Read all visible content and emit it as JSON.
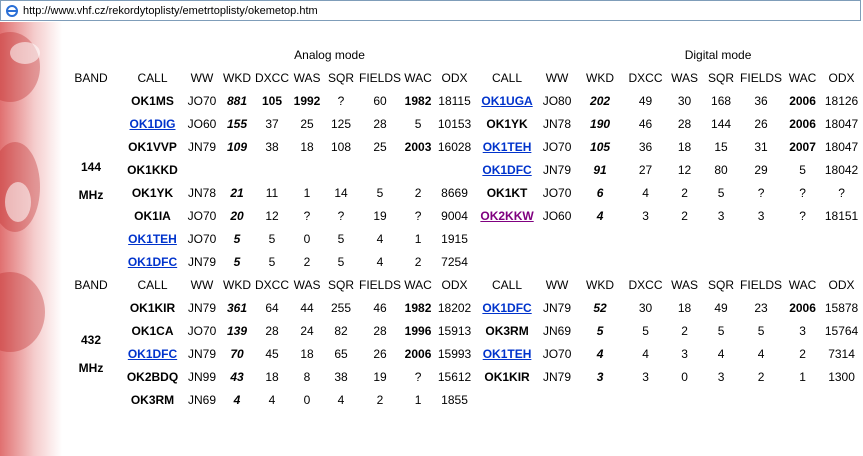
{
  "address_bar": {
    "url": "http://www.vhf.cz/rekordytoplisty/emetrtoplisty/okemetop.htm"
  },
  "colors": {
    "analog_header": "#f9bf6e",
    "digital_header": "#fffacd",
    "band_header": "#c8f0a8",
    "band_cell": "#c8f4f8",
    "highlight": "#ffff00",
    "link": "#0033cc",
    "visited_link": "#800080"
  },
  "modes": {
    "analog": "Analog mode",
    "digital": "Digital mode"
  },
  "headers": {
    "band": "BAND",
    "analog": [
      "CALL",
      "WW",
      "WKD",
      "DXCC",
      "WAS",
      "SQR",
      "FIELDS",
      "WAC",
      "ODX"
    ],
    "digital": [
      "CALL",
      "WW",
      "WKD",
      "DXCC",
      "WAS",
      "SQR",
      "FIELDS",
      "WAC",
      "ODX"
    ]
  },
  "bands": [
    {
      "label_top": "144",
      "label_bottom": "MHz",
      "analog_rows": [
        [
          "OK1MS",
          "JO70",
          "881",
          "105",
          "1992",
          "?",
          "60",
          "1982",
          "18115"
        ],
        [
          "OK1DIG",
          "JO60",
          "155",
          "37",
          "25",
          "125",
          "28",
          "5",
          "10153"
        ],
        [
          "OK1VVP",
          "JN79",
          "109",
          "38",
          "18",
          "108",
          "25",
          "2003",
          "16028"
        ],
        [
          "OK1KKD",
          "",
          "",
          "",
          "",
          "",
          "",
          "",
          ""
        ],
        [
          "OK1YK",
          "JN78",
          "21",
          "11",
          "1",
          "14",
          "5",
          "2",
          "8669"
        ],
        [
          "OK1IA",
          "JO70",
          "20",
          "12",
          "?",
          "?",
          "19",
          "?",
          "9004"
        ],
        [
          "OK1TEH",
          "JO70",
          "5",
          "5",
          "0",
          "5",
          "4",
          "1",
          "1915"
        ],
        [
          "OK1DFC",
          "JN79",
          "5",
          "5",
          "2",
          "5",
          "4",
          "2",
          "7254"
        ]
      ],
      "digital_rows": [
        [
          "OK1UGA",
          "JO80",
          "202",
          "49",
          "30",
          "168",
          "36",
          "2006",
          "18126"
        ],
        [
          "OK1YK",
          "JN78",
          "190",
          "46",
          "28",
          "144",
          "26",
          "2006",
          "18047"
        ],
        [
          "OK1TEH",
          "JO70",
          "105",
          "36",
          "18",
          "15",
          "31",
          "2007",
          "18047"
        ],
        [
          "OK1DFC",
          "JN79",
          "91",
          "27",
          "12",
          "80",
          "29",
          "5",
          "18042"
        ],
        [
          "OK1KT",
          "JO70",
          "6",
          "4",
          "2",
          "5",
          "?",
          "?",
          "?"
        ],
        [
          "OK2KKW",
          "JO60",
          "4",
          "3",
          "2",
          "3",
          "3",
          "?",
          "18151"
        ]
      ]
    },
    {
      "label_top": "432",
      "label_bottom": "MHz",
      "analog_rows": [
        [
          "OK1KIR",
          "JN79",
          "361",
          "64",
          "44",
          "255",
          "46",
          "1982",
          "18202"
        ],
        [
          "OK1CA",
          "JO70",
          "139",
          "28",
          "24",
          "82",
          "28",
          "1996",
          "15913"
        ],
        [
          "OK1DFC",
          "JN79",
          "70",
          "45",
          "18",
          "65",
          "26",
          "2006",
          "15993"
        ],
        [
          "OK2BDQ",
          "JN99",
          "43",
          "18",
          "8",
          "38",
          "19",
          "?",
          "15612"
        ],
        [
          "OK3RM",
          "JN69",
          "4",
          "4",
          "0",
          "4",
          "2",
          "1",
          "1855"
        ]
      ],
      "digital_rows": [
        [
          "OK1DFC",
          "JN79",
          "52",
          "30",
          "18",
          "49",
          "23",
          "2006",
          "15878"
        ],
        [
          "OK3RM",
          "JN69",
          "5",
          "5",
          "2",
          "5",
          "5",
          "3",
          "15764"
        ],
        [
          "OK1TEH",
          "JO70",
          "4",
          "4",
          "3",
          "4",
          "4",
          "2",
          "7314"
        ],
        [
          "OK1KIR",
          "JN79",
          "3",
          "3",
          "0",
          "3",
          "2",
          "1",
          "1300"
        ]
      ]
    }
  ]
}
